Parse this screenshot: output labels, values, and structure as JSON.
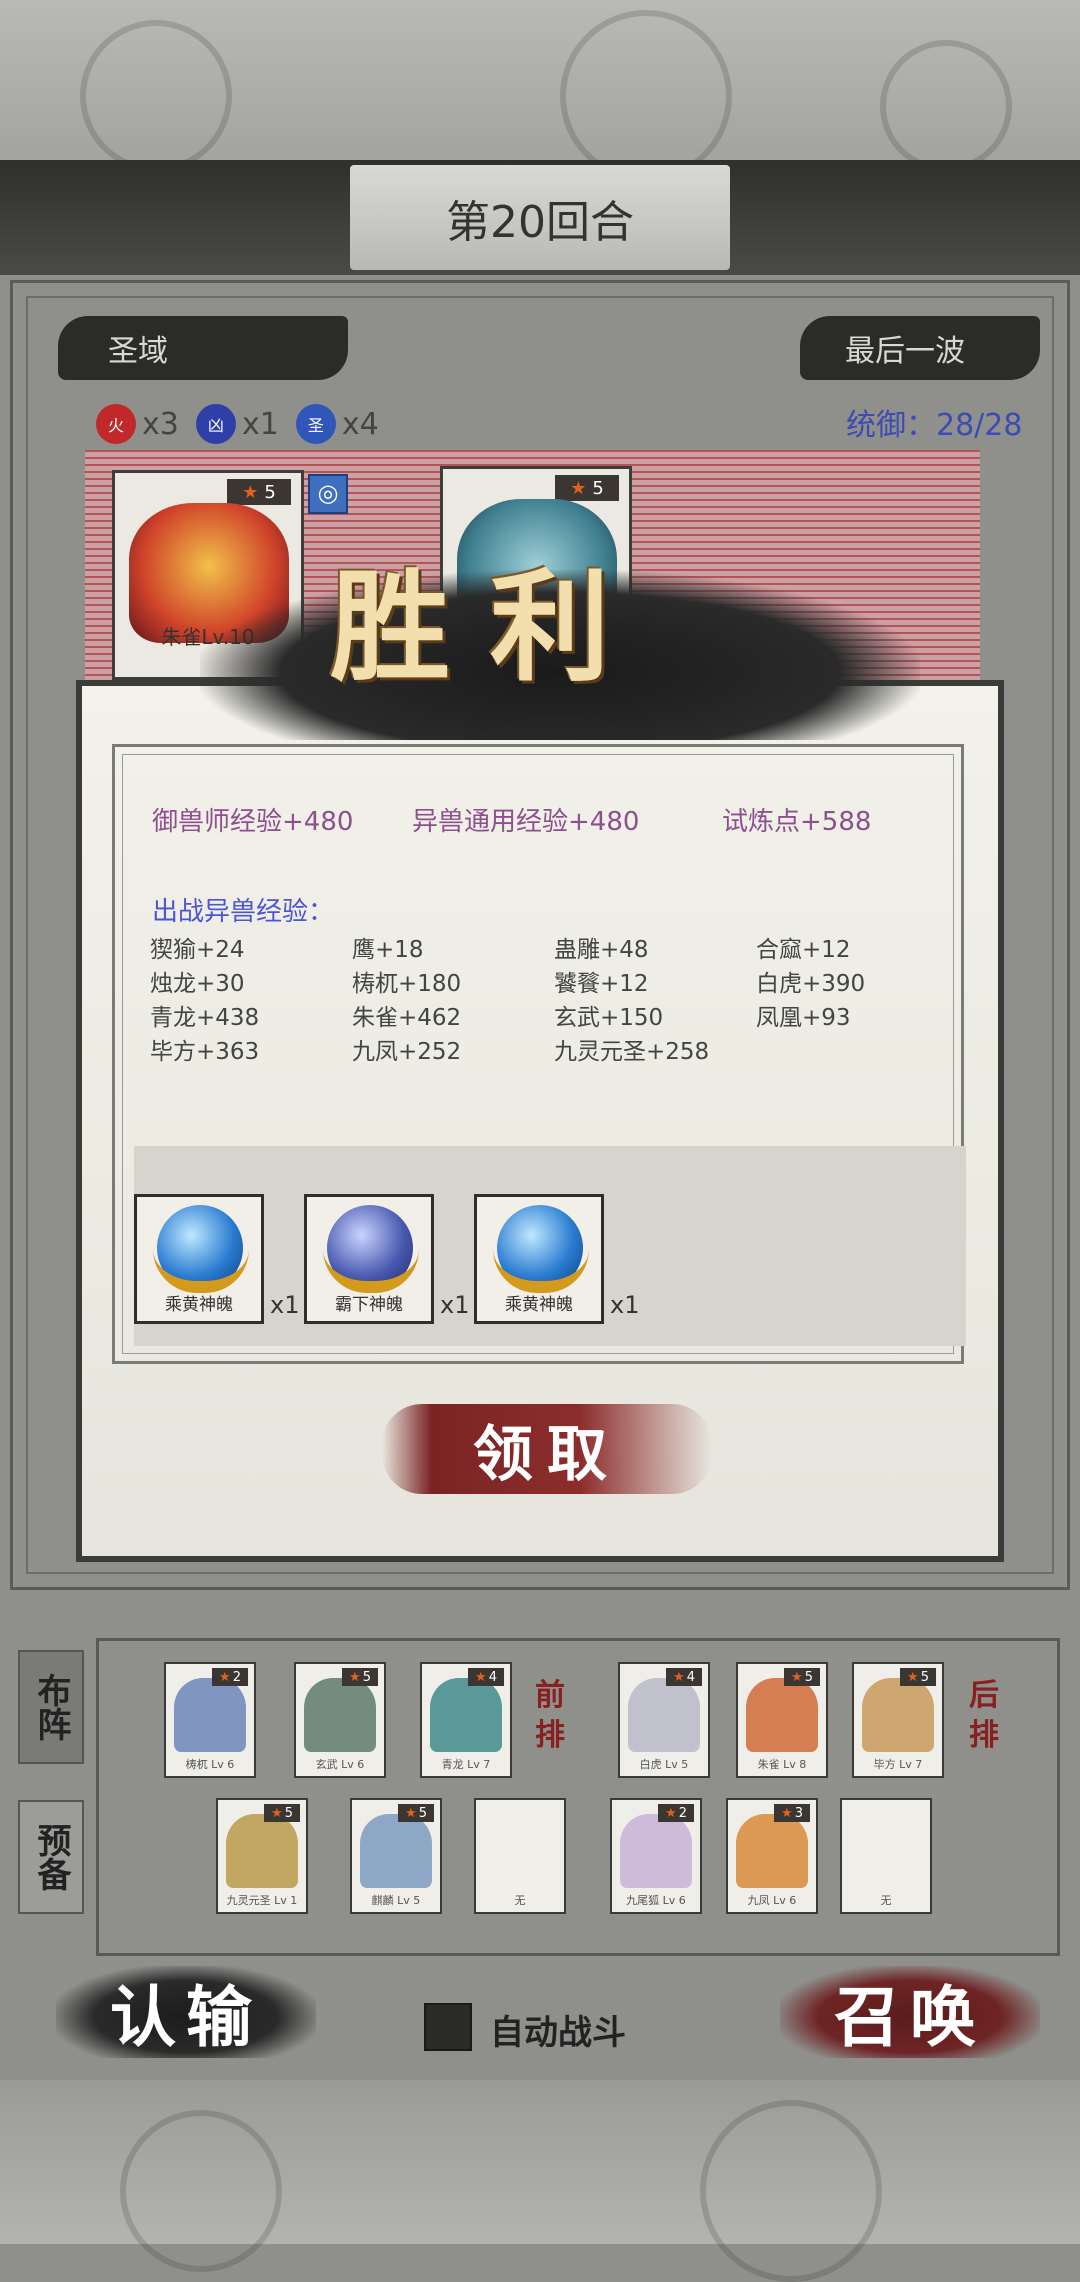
{
  "header": {
    "round_title": "第20回合"
  },
  "battle": {
    "zone_label": "圣域",
    "wave_label": "最后一波",
    "elements": [
      {
        "symbol": "火",
        "count": "x3",
        "color": "#c0282a"
      },
      {
        "symbol": "凶",
        "count": "x1",
        "color": "#2f3fa8"
      },
      {
        "symbol": "圣",
        "count": "x4",
        "color": "#2f56b8"
      }
    ],
    "command_label": "统御：28/28",
    "enemy_cards": [
      {
        "stars": "5",
        "name": "朱雀Lv.10"
      },
      {
        "stars": "5",
        "name": ""
      }
    ]
  },
  "victory": {
    "title": "胜利",
    "rewards": {
      "trainer_exp": "御兽师经验+480",
      "common_exp": "异兽通用经验+480",
      "trial_points": "试炼点+588"
    },
    "beast_exp_title": "出战异兽经验：",
    "beast_exp": [
      "猰㺄+24",
      "鹰+18",
      "蛊雕+48",
      "合窳+12",
      "烛龙+30",
      "梼杌+180",
      "饕餮+12",
      "白虎+390",
      "青龙+438",
      "朱雀+462",
      "玄武+150",
      "凤凰+93",
      "毕方+363",
      "九凤+252",
      "九灵元圣+258"
    ],
    "items": [
      {
        "name": "乘黄神魄",
        "qty": "x1"
      },
      {
        "name": "霸下神魄",
        "qty": "x1"
      },
      {
        "name": "乘黄神魄",
        "qty": "x1"
      }
    ],
    "claim_label": "领取"
  },
  "lineup": {
    "tab_formation": "布阵",
    "tab_reserve": "预备",
    "front_label": "前排",
    "back_label": "后排",
    "front_row": [
      {
        "stars": "2",
        "name": "梼杌 Lv 6",
        "color": "#6c86b8"
      },
      {
        "stars": "5",
        "name": "玄武 Lv 6",
        "color": "#5d7a6a"
      },
      {
        "stars": "4",
        "name": "青龙 Lv 7",
        "color": "#3f8a8a"
      }
    ],
    "back_row": [
      {
        "stars": "4",
        "name": "白虎 Lv 5",
        "color": "#b8b8c8"
      },
      {
        "stars": "5",
        "name": "朱雀 Lv 8",
        "color": "#d06a3a"
      },
      {
        "stars": "5",
        "name": "毕方 Lv 7",
        "color": "#c89a5a"
      }
    ],
    "reserve_row": [
      {
        "stars": "5",
        "name": "九灵元圣 Lv 1",
        "color": "#b89a4a"
      },
      {
        "stars": "5",
        "name": "麒麟 Lv 5",
        "color": "#7e9ac0"
      },
      {
        "stars": "",
        "name": "无",
        "color": ""
      },
      {
        "stars": "2",
        "name": "九尾狐 Lv 6",
        "color": "#c8b0d8"
      },
      {
        "stars": "3",
        "name": "九凤 Lv 6",
        "color": "#d88a3a"
      },
      {
        "stars": "",
        "name": "无",
        "color": ""
      }
    ]
  },
  "controls": {
    "surrender_label": "认输",
    "auto_battle_label": "自动战斗",
    "summon_label": "召唤"
  }
}
